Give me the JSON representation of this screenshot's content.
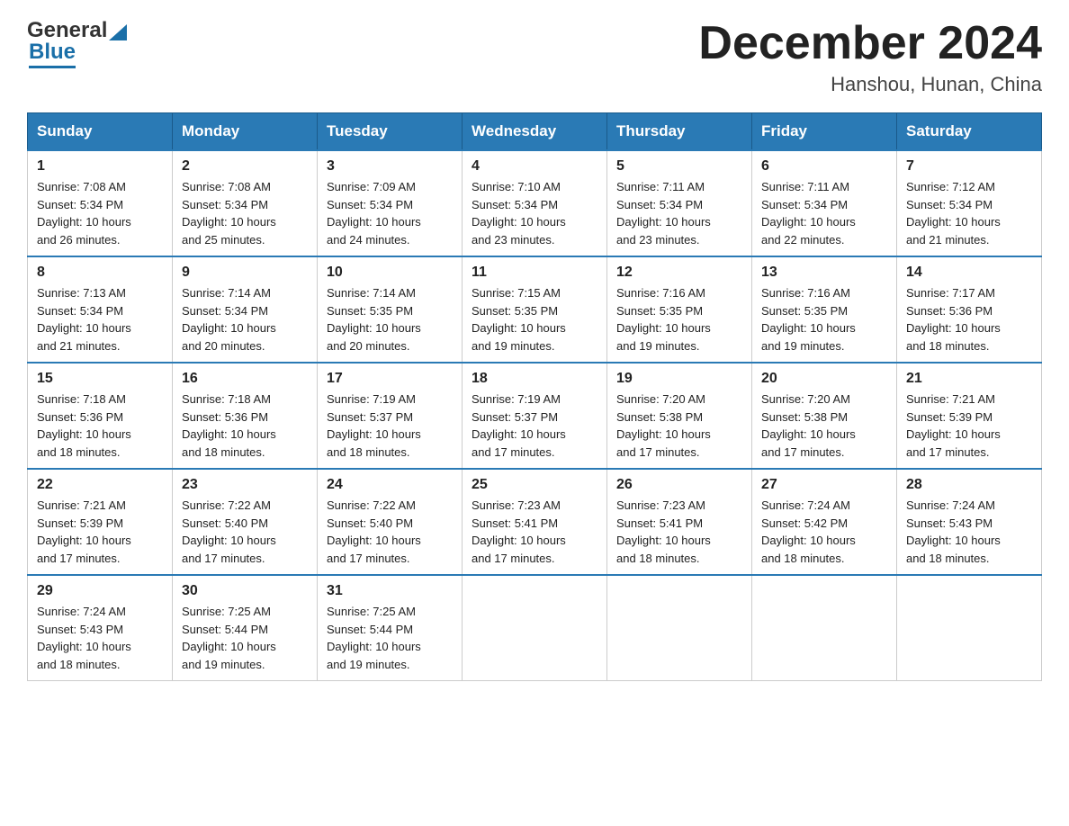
{
  "header": {
    "logo_general": "General",
    "logo_blue": "Blue",
    "month_year": "December 2024",
    "location": "Hanshou, Hunan, China"
  },
  "days_of_week": [
    "Sunday",
    "Monday",
    "Tuesday",
    "Wednesday",
    "Thursday",
    "Friday",
    "Saturday"
  ],
  "weeks": [
    [
      {
        "day": "1",
        "sunrise": "7:08 AM",
        "sunset": "5:34 PM",
        "daylight": "10 hours and 26 minutes."
      },
      {
        "day": "2",
        "sunrise": "7:08 AM",
        "sunset": "5:34 PM",
        "daylight": "10 hours and 25 minutes."
      },
      {
        "day": "3",
        "sunrise": "7:09 AM",
        "sunset": "5:34 PM",
        "daylight": "10 hours and 24 minutes."
      },
      {
        "day": "4",
        "sunrise": "7:10 AM",
        "sunset": "5:34 PM",
        "daylight": "10 hours and 23 minutes."
      },
      {
        "day": "5",
        "sunrise": "7:11 AM",
        "sunset": "5:34 PM",
        "daylight": "10 hours and 23 minutes."
      },
      {
        "day": "6",
        "sunrise": "7:11 AM",
        "sunset": "5:34 PM",
        "daylight": "10 hours and 22 minutes."
      },
      {
        "day": "7",
        "sunrise": "7:12 AM",
        "sunset": "5:34 PM",
        "daylight": "10 hours and 21 minutes."
      }
    ],
    [
      {
        "day": "8",
        "sunrise": "7:13 AM",
        "sunset": "5:34 PM",
        "daylight": "10 hours and 21 minutes."
      },
      {
        "day": "9",
        "sunrise": "7:14 AM",
        "sunset": "5:34 PM",
        "daylight": "10 hours and 20 minutes."
      },
      {
        "day": "10",
        "sunrise": "7:14 AM",
        "sunset": "5:35 PM",
        "daylight": "10 hours and 20 minutes."
      },
      {
        "day": "11",
        "sunrise": "7:15 AM",
        "sunset": "5:35 PM",
        "daylight": "10 hours and 19 minutes."
      },
      {
        "day": "12",
        "sunrise": "7:16 AM",
        "sunset": "5:35 PM",
        "daylight": "10 hours and 19 minutes."
      },
      {
        "day": "13",
        "sunrise": "7:16 AM",
        "sunset": "5:35 PM",
        "daylight": "10 hours and 19 minutes."
      },
      {
        "day": "14",
        "sunrise": "7:17 AM",
        "sunset": "5:36 PM",
        "daylight": "10 hours and 18 minutes."
      }
    ],
    [
      {
        "day": "15",
        "sunrise": "7:18 AM",
        "sunset": "5:36 PM",
        "daylight": "10 hours and 18 minutes."
      },
      {
        "day": "16",
        "sunrise": "7:18 AM",
        "sunset": "5:36 PM",
        "daylight": "10 hours and 18 minutes."
      },
      {
        "day": "17",
        "sunrise": "7:19 AM",
        "sunset": "5:37 PM",
        "daylight": "10 hours and 18 minutes."
      },
      {
        "day": "18",
        "sunrise": "7:19 AM",
        "sunset": "5:37 PM",
        "daylight": "10 hours and 17 minutes."
      },
      {
        "day": "19",
        "sunrise": "7:20 AM",
        "sunset": "5:38 PM",
        "daylight": "10 hours and 17 minutes."
      },
      {
        "day": "20",
        "sunrise": "7:20 AM",
        "sunset": "5:38 PM",
        "daylight": "10 hours and 17 minutes."
      },
      {
        "day": "21",
        "sunrise": "7:21 AM",
        "sunset": "5:39 PM",
        "daylight": "10 hours and 17 minutes."
      }
    ],
    [
      {
        "day": "22",
        "sunrise": "7:21 AM",
        "sunset": "5:39 PM",
        "daylight": "10 hours and 17 minutes."
      },
      {
        "day": "23",
        "sunrise": "7:22 AM",
        "sunset": "5:40 PM",
        "daylight": "10 hours and 17 minutes."
      },
      {
        "day": "24",
        "sunrise": "7:22 AM",
        "sunset": "5:40 PM",
        "daylight": "10 hours and 17 minutes."
      },
      {
        "day": "25",
        "sunrise": "7:23 AM",
        "sunset": "5:41 PM",
        "daylight": "10 hours and 17 minutes."
      },
      {
        "day": "26",
        "sunrise": "7:23 AM",
        "sunset": "5:41 PM",
        "daylight": "10 hours and 18 minutes."
      },
      {
        "day": "27",
        "sunrise": "7:24 AM",
        "sunset": "5:42 PM",
        "daylight": "10 hours and 18 minutes."
      },
      {
        "day": "28",
        "sunrise": "7:24 AM",
        "sunset": "5:43 PM",
        "daylight": "10 hours and 18 minutes."
      }
    ],
    [
      {
        "day": "29",
        "sunrise": "7:24 AM",
        "sunset": "5:43 PM",
        "daylight": "10 hours and 18 minutes."
      },
      {
        "day": "30",
        "sunrise": "7:25 AM",
        "sunset": "5:44 PM",
        "daylight": "10 hours and 19 minutes."
      },
      {
        "day": "31",
        "sunrise": "7:25 AM",
        "sunset": "5:44 PM",
        "daylight": "10 hours and 19 minutes."
      },
      null,
      null,
      null,
      null
    ]
  ],
  "labels": {
    "sunrise": "Sunrise:",
    "sunset": "Sunset:",
    "daylight": "Daylight:"
  }
}
